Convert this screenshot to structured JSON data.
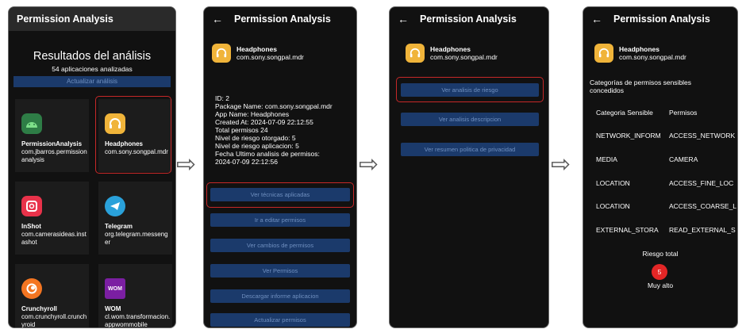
{
  "app_title": "Permission Analysis",
  "back_glyph": "←",
  "arrow_glyph": "⇨",
  "screen1": {
    "results_title": "Resultados del análisis",
    "results_sub": "54 aplicaciones analizadas",
    "update_button": "Actualizar análisis",
    "apps": [
      {
        "name": "PermissionAnalysis",
        "package": "com.jbarros.permissionanalysis",
        "icon": "android-icon",
        "color": "#2e7d46"
      },
      {
        "name": "Headphones",
        "package": "com.sony.songpal.mdr",
        "icon": "headphones-icon",
        "color": "#f0b43a"
      },
      {
        "name": "InShot",
        "package": "com.camerasideas.instashot",
        "icon": "inshot-icon",
        "color": "#e8324a"
      },
      {
        "name": "Telegram",
        "package": "org.telegram.messenger",
        "icon": "telegram-icon",
        "color": "#2aa1da"
      },
      {
        "name": "Crunchyroll",
        "package": "com.crunchyroll.crunchyroid",
        "icon": "crunchyroll-icon",
        "color": "#f47521"
      },
      {
        "name": "WOM",
        "package": "cl.wom.transformacion.appwommobile",
        "icon": "wom-icon",
        "color": "#7b1fa2"
      }
    ]
  },
  "app_detail": {
    "name": "Headphones",
    "package": "com.sony.songpal.mdr"
  },
  "screen2": {
    "info": [
      "ID: 2",
      "Package Name: com.sony.songpal.mdr",
      "App Name: Headphones",
      "Created At: 2024-07-09 22:12:55",
      "Total permisos 24",
      "Nivel de riesgo otorgado: 5",
      "Nivel de riesgo aplicacion: 5",
      "Fecha Ultimo analisis de permisos:",
      "2024-07-09 22:12:56"
    ],
    "buttons": [
      "Ver técnicas aplicadas",
      "Ir a editar permisos",
      "Ver cambios de permisos",
      "Ver Permisos",
      "Descargar informe aplicacion",
      "Actualizar permisos"
    ]
  },
  "screen3": {
    "buttons": [
      "Ver analisis de riesgo",
      "Ver analisis descripcion",
      "Ver resumen politica de privacidad"
    ]
  },
  "screen4": {
    "categories_title": "Categorías de permisos sensibles concedidos",
    "header": [
      "Categoria Sensible",
      "Permisos"
    ],
    "rows": [
      [
        "NETWORK_INFORM",
        "ACCESS_NETWORK"
      ],
      [
        "MEDIA",
        "CAMERA"
      ],
      [
        "LOCATION",
        "ACCESS_FINE_LOC"
      ],
      [
        "LOCATION",
        "ACCESS_COARSE_L"
      ],
      [
        "EXTERNAL_STORA",
        "READ_EXTERNAL_S"
      ]
    ],
    "risk_label": "Riesgo total",
    "risk_value": "5",
    "risk_level": "Muy alto"
  }
}
